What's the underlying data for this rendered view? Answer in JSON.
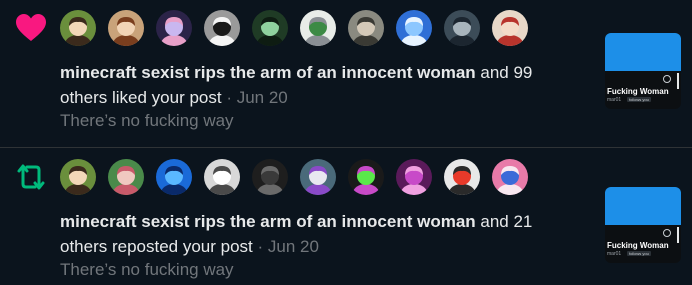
{
  "notifications": [
    {
      "kind": "like",
      "type_icon": "heart-icon",
      "type_color": "#f91880",
      "avatars": [
        {
          "icon": "avatar-anime-girl-blonde",
          "bg": "#6a8f3c",
          "fg": "#f2d7b8",
          "accent": "#3b2a1c"
        },
        {
          "icon": "avatar-anime-girl-brown-hat",
          "bg": "#c9a37a",
          "fg": "#f1d4b6",
          "accent": "#7a3e1e"
        },
        {
          "icon": "avatar-purple-creature",
          "bg": "#2b2348",
          "fg": "#c9b7f0",
          "accent": "#e8a0c8"
        },
        {
          "icon": "avatar-black-cat",
          "bg": "#9a9a9a",
          "fg": "#1a1a1a",
          "accent": "#f5f5f5"
        },
        {
          "icon": "avatar-green-portrait",
          "bg": "#1f3b25",
          "fg": "#8fd19e",
          "accent": "#0e1c12"
        },
        {
          "icon": "avatar-plant-pot",
          "bg": "#e8ece8",
          "fg": "#3c8a45",
          "accent": "#8a8f94"
        },
        {
          "icon": "avatar-man-grey",
          "bg": "#8a8a80",
          "fg": "#d4c9b8",
          "accent": "#3a3a34"
        },
        {
          "icon": "avatar-blue-bubble",
          "bg": "#2f6fd6",
          "fg": "#8cc7ff",
          "accent": "#e8f4ff"
        },
        {
          "icon": "avatar-grey-figure",
          "bg": "#3c4c58",
          "fg": "#a8b4bc",
          "accent": "#1c2630"
        },
        {
          "icon": "avatar-anime-girl-red",
          "bg": "#e8d8c8",
          "fg": "#f4dcc8",
          "accent": "#b8342c"
        }
      ],
      "actor": "minecraft sexist rips the arm of an innocent woman",
      "line1_rest": " and 99",
      "line2_text": "others liked your post",
      "separator": " · ",
      "date": "Jun 20",
      "snippet": "There’s no fucking way",
      "thumbnail": {
        "name": "Fucking Woman",
        "handle": "mar01",
        "follows": "follows you"
      }
    },
    {
      "kind": "repost",
      "type_icon": "repost-icon",
      "type_color": "#00ba7c",
      "avatars": [
        {
          "icon": "avatar-anime-girl-blonde",
          "bg": "#6a8f3c",
          "fg": "#f2d7b8",
          "accent": "#3b2a1c"
        },
        {
          "icon": "avatar-anime-girl-pink",
          "bg": "#4a8a4a",
          "fg": "#f0c8c0",
          "accent": "#c85a6a"
        },
        {
          "icon": "avatar-blue-mascot",
          "bg": "#1a6ad8",
          "fg": "#5ab8ff",
          "accent": "#0a2a6a"
        },
        {
          "icon": "avatar-white-sketch",
          "bg": "#d8d8d8",
          "fg": "#ffffff",
          "accent": "#4a4a4a"
        },
        {
          "icon": "avatar-dark-room",
          "bg": "#1e1e1e",
          "fg": "#3a3a3a",
          "accent": "#6a6a6a"
        },
        {
          "icon": "avatar-anime-girl-white-hair",
          "bg": "#4a6a7a",
          "fg": "#e8e8f0",
          "accent": "#8a4ac8"
        },
        {
          "icon": "avatar-green-splatoon",
          "bg": "#1a1a1a",
          "fg": "#5ae84a",
          "accent": "#c84ac8"
        },
        {
          "icon": "avatar-purple-character",
          "bg": "#5a1a5a",
          "fg": "#c84ac8",
          "accent": "#f0a0e0"
        },
        {
          "icon": "avatar-anime-girl-red-hair",
          "bg": "#e8e8e8",
          "fg": "#e83a2a",
          "accent": "#2a2a2a"
        },
        {
          "icon": "avatar-pink-blue-character",
          "bg": "#e87aa8",
          "fg": "#3a6ad8",
          "accent": "#f8e8f0"
        }
      ],
      "actor": "minecraft sexist rips the arm of an innocent woman",
      "line1_rest": " and 21",
      "line2_text": "others reposted your post",
      "separator": " · ",
      "date": "Jun 20",
      "snippet": "There’s no fucking way",
      "thumbnail": {
        "name": "Fucking Woman",
        "handle": "mar01",
        "follows": "follows you"
      }
    }
  ]
}
